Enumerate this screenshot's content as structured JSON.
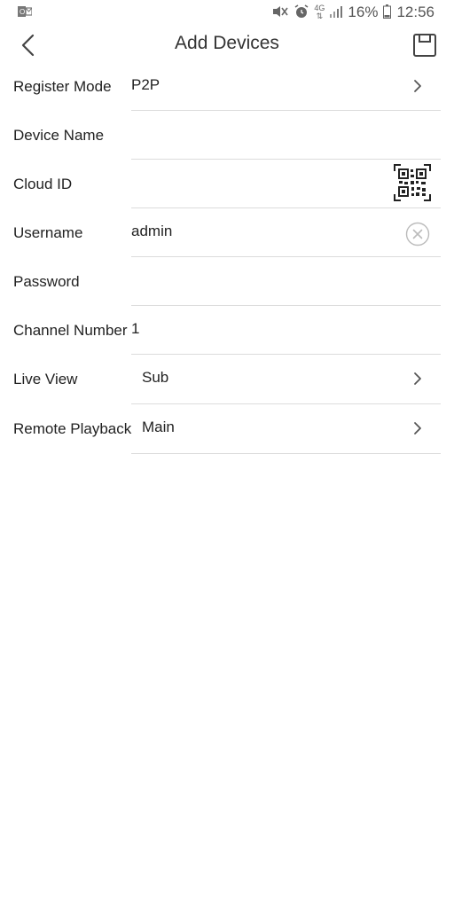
{
  "status_bar": {
    "battery": "16%",
    "time": "12:56",
    "network": "4G",
    "icons": [
      "outlook-icon",
      "mute-vibrate-icon",
      "alarm-icon",
      "network-4g-icon",
      "signal-icon",
      "battery-icon"
    ]
  },
  "header": {
    "title": "Add Devices",
    "back_icon": "chevron-left-icon",
    "save_icon": "save-icon"
  },
  "form": {
    "register_mode": {
      "label": "Register Mode",
      "value": "P2P"
    },
    "device_name": {
      "label": "Device Name",
      "value": ""
    },
    "cloud_id": {
      "label": "Cloud ID",
      "value": ""
    },
    "username": {
      "label": "Username",
      "value": "admin"
    },
    "password": {
      "label": "Password",
      "value": ""
    },
    "channel_number": {
      "label": "Channel Number",
      "value": "1"
    },
    "live_view": {
      "label": "Live View",
      "value": "Sub"
    },
    "remote_playback": {
      "label": "Remote Playback",
      "value": "Main"
    }
  },
  "colors": {
    "background": "#ffffff",
    "text": "#222222",
    "divider": "#dcdcdc",
    "icon": "#555555"
  }
}
